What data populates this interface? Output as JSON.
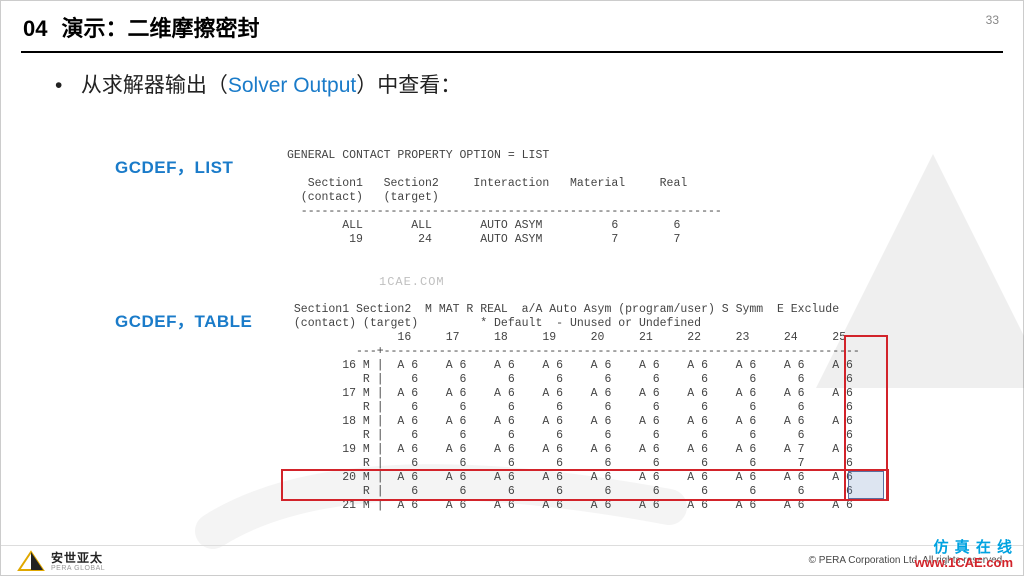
{
  "header": {
    "section_number": "04",
    "title": "演示：二维摩擦密封",
    "page_number": "33"
  },
  "bullet": {
    "prefix": "从求解器输出（",
    "solver_output": "Solver Output",
    "suffix": "）中查看："
  },
  "labels": {
    "list": "GCDEF，LIST",
    "table": "GCDEF，TABLE"
  },
  "list_block": "GENERAL CONTACT PROPERTY OPTION = LIST\n\n   Section1   Section2     Interaction   Material     Real\n  (contact)   (target)\n  -------------------------------------------------------------\n        ALL       ALL       AUTO ASYM          6        6\n         19        24       AUTO ASYM          7        7",
  "table_block": " Section1 Section2  M MAT R REAL  a/A Auto Asym (program/user) S Symm  E Exclude\n (contact) (target)         * Default  - Unused or Undefined\n                16     17     18     19     20     21     22     23     24     25\n          ---+---------------------------------------------------------------------\n        16 M |  A 6    A 6    A 6    A 6    A 6    A 6    A 6    A 6    A 6    A 6\n           R |    6      6      6      6      6      6      6      6      6      6\n        17 M |  A 6    A 6    A 6    A 6    A 6    A 6    A 6    A 6    A 6    A 6\n           R |    6      6      6      6      6      6      6      6      6      6\n        18 M |  A 6    A 6    A 6    A 6    A 6    A 6    A 6    A 6    A 6    A 6\n           R |    6      6      6      6      6      6      6      6      6      6\n        19 M |  A 6    A 6    A 6    A 6    A 6    A 6    A 6    A 6    A 7    A 6\n           R |    6      6      6      6      6      6      6      6      7      6\n        20 M |  A 6    A 6    A 6    A 6    A 6    A 6    A 6    A 6    A 6    A 6\n           R |    6      6      6      6      6      6      6      6      6      6\n        21 M |  A 6    A 6    A 6    A 6    A 6    A 6    A 6    A 6    A 6    A 6",
  "watermark": {
    "text": "1CAE.COM"
  },
  "footer": {
    "brand_cn": "安世亚太",
    "brand_en": "PERA GLOBAL",
    "copyright": "©   PERA Corporation Ltd. All rights reserved."
  },
  "sitemark": {
    "cn": "仿 真 在 线",
    "url": "www.1CAE.com"
  }
}
